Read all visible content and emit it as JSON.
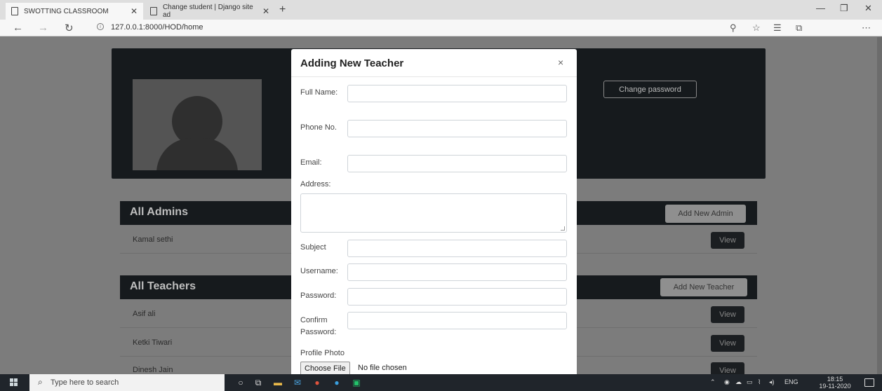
{
  "browser": {
    "tabs": [
      {
        "title": "SWOTTING CLASSROOM"
      },
      {
        "title": "Change student | Django site ad"
      }
    ],
    "url": "127.0.0.1:8000/HOD/home"
  },
  "profile": {
    "change_password_label": "Change password"
  },
  "admins": {
    "title": "All Admins",
    "add_label": "Add New Admin",
    "rows": [
      {
        "name": "Kamal sethi",
        "action": "View"
      }
    ]
  },
  "teachers": {
    "title": "All Teachers",
    "add_label": "Add New Teacher",
    "rows": [
      {
        "name": "Asif ali",
        "action": "View"
      },
      {
        "name": "Ketki Tiwari",
        "action": "View"
      },
      {
        "name": "Dinesh Jain",
        "action": "View"
      }
    ]
  },
  "modal": {
    "title": "Adding New Teacher",
    "close": "×",
    "fields": {
      "full_name": {
        "label": "Full Name:",
        "value": ""
      },
      "phone": {
        "label": "Phone No.",
        "value": ""
      },
      "email": {
        "label": "Email:",
        "value": ""
      },
      "address": {
        "label": "Address:",
        "value": ""
      },
      "subject": {
        "label": "Subject",
        "value": ""
      },
      "username": {
        "label": "Username:",
        "value": ""
      },
      "password": {
        "label": "Password:",
        "value": ""
      },
      "confirm_password": {
        "label": "Confirm Password:",
        "value": ""
      },
      "profile_photo": {
        "label": "Profile Photo",
        "button": "Choose File",
        "status": "No file chosen"
      }
    }
  },
  "taskbar": {
    "search_placeholder": "Type here to search",
    "language": "ENG",
    "time": "18:15",
    "date": "19-11-2020"
  },
  "colors": {
    "modal_bg": "#ffffff",
    "panel_dark": "#161a1d",
    "backdrop": "#7c7c7c",
    "taskbar": "#20252b"
  }
}
